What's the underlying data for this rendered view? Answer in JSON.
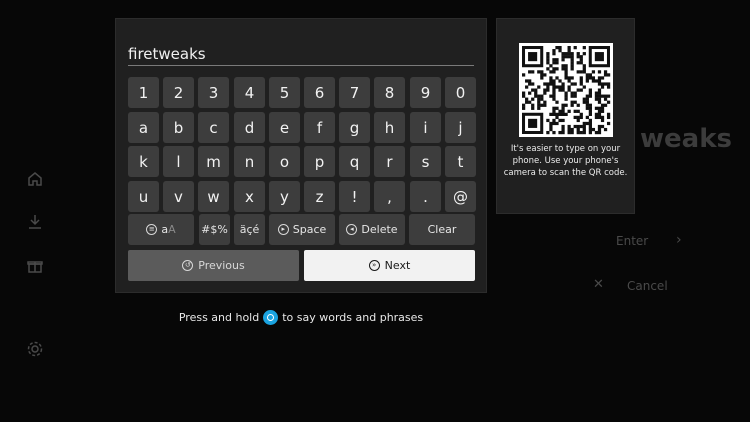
{
  "background": {
    "title_fragment": "weaks",
    "enter_label": "Enter",
    "cancel_label": "Cancel"
  },
  "keyboard": {
    "input_value": "firetweaks",
    "rows": [
      [
        "1",
        "2",
        "3",
        "4",
        "5",
        "6",
        "7",
        "8",
        "9",
        "0"
      ],
      [
        "a",
        "b",
        "c",
        "d",
        "e",
        "f",
        "g",
        "h",
        "i",
        "j"
      ],
      [
        "k",
        "l",
        "m",
        "n",
        "o",
        "p",
        "q",
        "r",
        "s",
        "t"
      ],
      [
        "u",
        "v",
        "w",
        "x",
        "y",
        "z",
        "!",
        ",",
        ".",
        "@"
      ]
    ],
    "function_keys": {
      "case_label_main": "a",
      "case_label_alt": "A",
      "symbols": "#$%",
      "accents": "äçé",
      "space": "Space",
      "delete": "Delete",
      "clear": "Clear"
    },
    "previous_label": "Previous",
    "next_label": "Next"
  },
  "qr": {
    "instructions": "It's easier to type on your phone. Use your phone's camera to scan the QR code."
  },
  "hint": {
    "before": "Press and hold",
    "after": "to say words and phrases"
  },
  "colors": {
    "key_bg": "#3d3d3d",
    "panel_bg": "#202020",
    "next_bg": "#f2f2f2",
    "alexa_blue": "#1aa3e0"
  },
  "icons": [
    "home-icon",
    "download-icon",
    "gift-icon",
    "settings-icon",
    "enter-chevron-icon",
    "close-icon",
    "alexa-icon"
  ]
}
